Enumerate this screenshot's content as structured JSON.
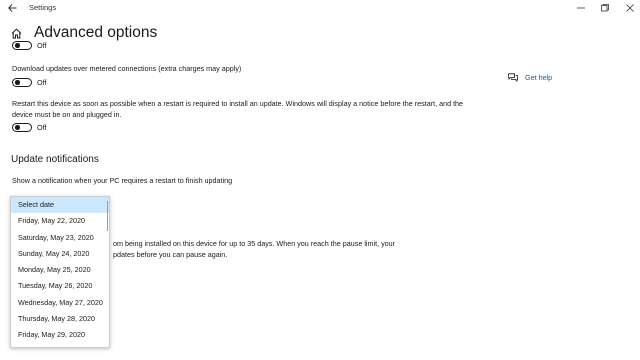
{
  "window": {
    "app_title": "Settings",
    "back_icon": "back-arrow-icon",
    "minimize_icon": "minimize-icon",
    "maximize_icon": "maximize-icon",
    "close_icon": "close-icon"
  },
  "header": {
    "home_icon": "home-icon",
    "title": "Advanced options"
  },
  "settings": {
    "top_toggle": {
      "state": "Off"
    },
    "metered": {
      "label": "Download updates over metered connections (extra charges may apply)",
      "state": "Off"
    },
    "restart": {
      "label_line1": "Restart this device as soon as possible when a restart is required to install an update. Windows will display a notice before the restart, and the",
      "label_line2": "device must be on and plugged in.",
      "state": "Off"
    }
  },
  "update_notifications": {
    "heading": "Update notifications",
    "label": "Show a notification when your PC requires a restart to finish updating"
  },
  "pause": {
    "line1": "om being installed on this device for up to 35 days. When you reach the pause limit, your",
    "line2": "pdates before you can pause again."
  },
  "help": {
    "icon": "chat-bubble-icon",
    "label": "Get help"
  },
  "dropdown": {
    "options": [
      "Select date",
      "Friday, May 22, 2020",
      "Saturday, May 23, 2020",
      "Sunday, May 24, 2020",
      "Monday, May 25, 2020",
      "Tuesday, May 26, 2020",
      "Wednesday, May 27, 2020",
      "Thursday, May 28, 2020",
      "Friday, May 29, 2020"
    ],
    "selected": "Select date"
  },
  "colors": {
    "link": "#0063b1",
    "selection": "#cce8ff"
  }
}
